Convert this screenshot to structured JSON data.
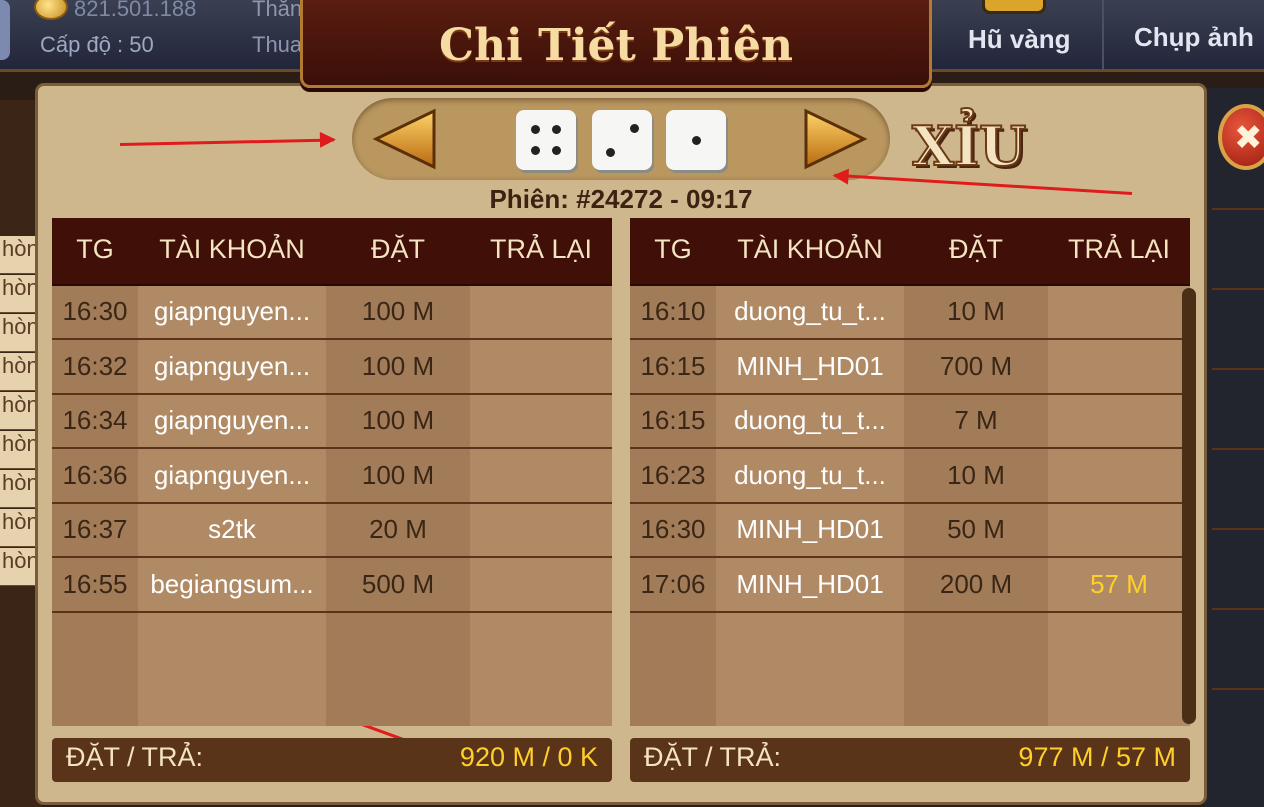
{
  "header": {
    "money": "821.501.188",
    "level": "Cấp độ : 50",
    "wins_label": "Thắng",
    "losses_label": "Thua",
    "title": "Chi Tiết Phiên",
    "jackpot_label": "Hũ vàng",
    "screenshot_label": "Chụp ảnh"
  },
  "session": {
    "label": "Phiên: #24272 - 09:17",
    "dice": [
      4,
      2,
      1
    ],
    "result": "XỈU"
  },
  "columns": [
    "TG",
    "TÀI KHOẢN",
    "ĐẶT",
    "TRẢ LẠI"
  ],
  "left_table": {
    "rows": [
      {
        "time": "16:30",
        "account": "giapnguyen...",
        "bet": "100 M",
        "refund": ""
      },
      {
        "time": "16:32",
        "account": "giapnguyen...",
        "bet": "100 M",
        "refund": ""
      },
      {
        "time": "16:34",
        "account": "giapnguyen...",
        "bet": "100 M",
        "refund": ""
      },
      {
        "time": "16:36",
        "account": "giapnguyen...",
        "bet": "100 M",
        "refund": ""
      },
      {
        "time": "16:37",
        "account": "s2tk",
        "bet": "20 M",
        "refund": ""
      },
      {
        "time": "16:55",
        "account": "begiangsum...",
        "bet": "500 M",
        "refund": ""
      }
    ],
    "footer_label": "ĐẶT / TRẢ:",
    "footer_value": "920 M / 0 K"
  },
  "right_table": {
    "rows": [
      {
        "time": "16:10",
        "account": "duong_tu_t...",
        "bet": "10 M",
        "refund": ""
      },
      {
        "time": "16:15",
        "account": "MINH_HD01",
        "bet": "700 M",
        "refund": ""
      },
      {
        "time": "16:15",
        "account": "duong_tu_t...",
        "bet": "7 M",
        "refund": ""
      },
      {
        "time": "16:23",
        "account": "duong_tu_t...",
        "bet": "10 M",
        "refund": ""
      },
      {
        "time": "16:30",
        "account": "MINH_HD01",
        "bet": "50 M",
        "refund": ""
      },
      {
        "time": "17:06",
        "account": "MINH_HD01",
        "bet": "200 M",
        "refund": "57 M"
      }
    ],
    "footer_label": "ĐẶT / TRẢ:",
    "footer_value": "977 M / 57 M"
  },
  "side_left_labels": [
    "hòng",
    "hòng",
    "hòng",
    "hòng",
    "hòng",
    "hòng",
    "hòng",
    "hòng",
    "hòng"
  ],
  "colors": {
    "panel": "#cfb78d",
    "header_row": "#3f0f08",
    "refund_text": "#ffcf2a",
    "annotation_arrow": "#e01b1b"
  },
  "icons": {
    "prev": "triangle-left-icon",
    "next": "triangle-right-icon",
    "close": "close-icon",
    "coin": "coin-icon"
  }
}
